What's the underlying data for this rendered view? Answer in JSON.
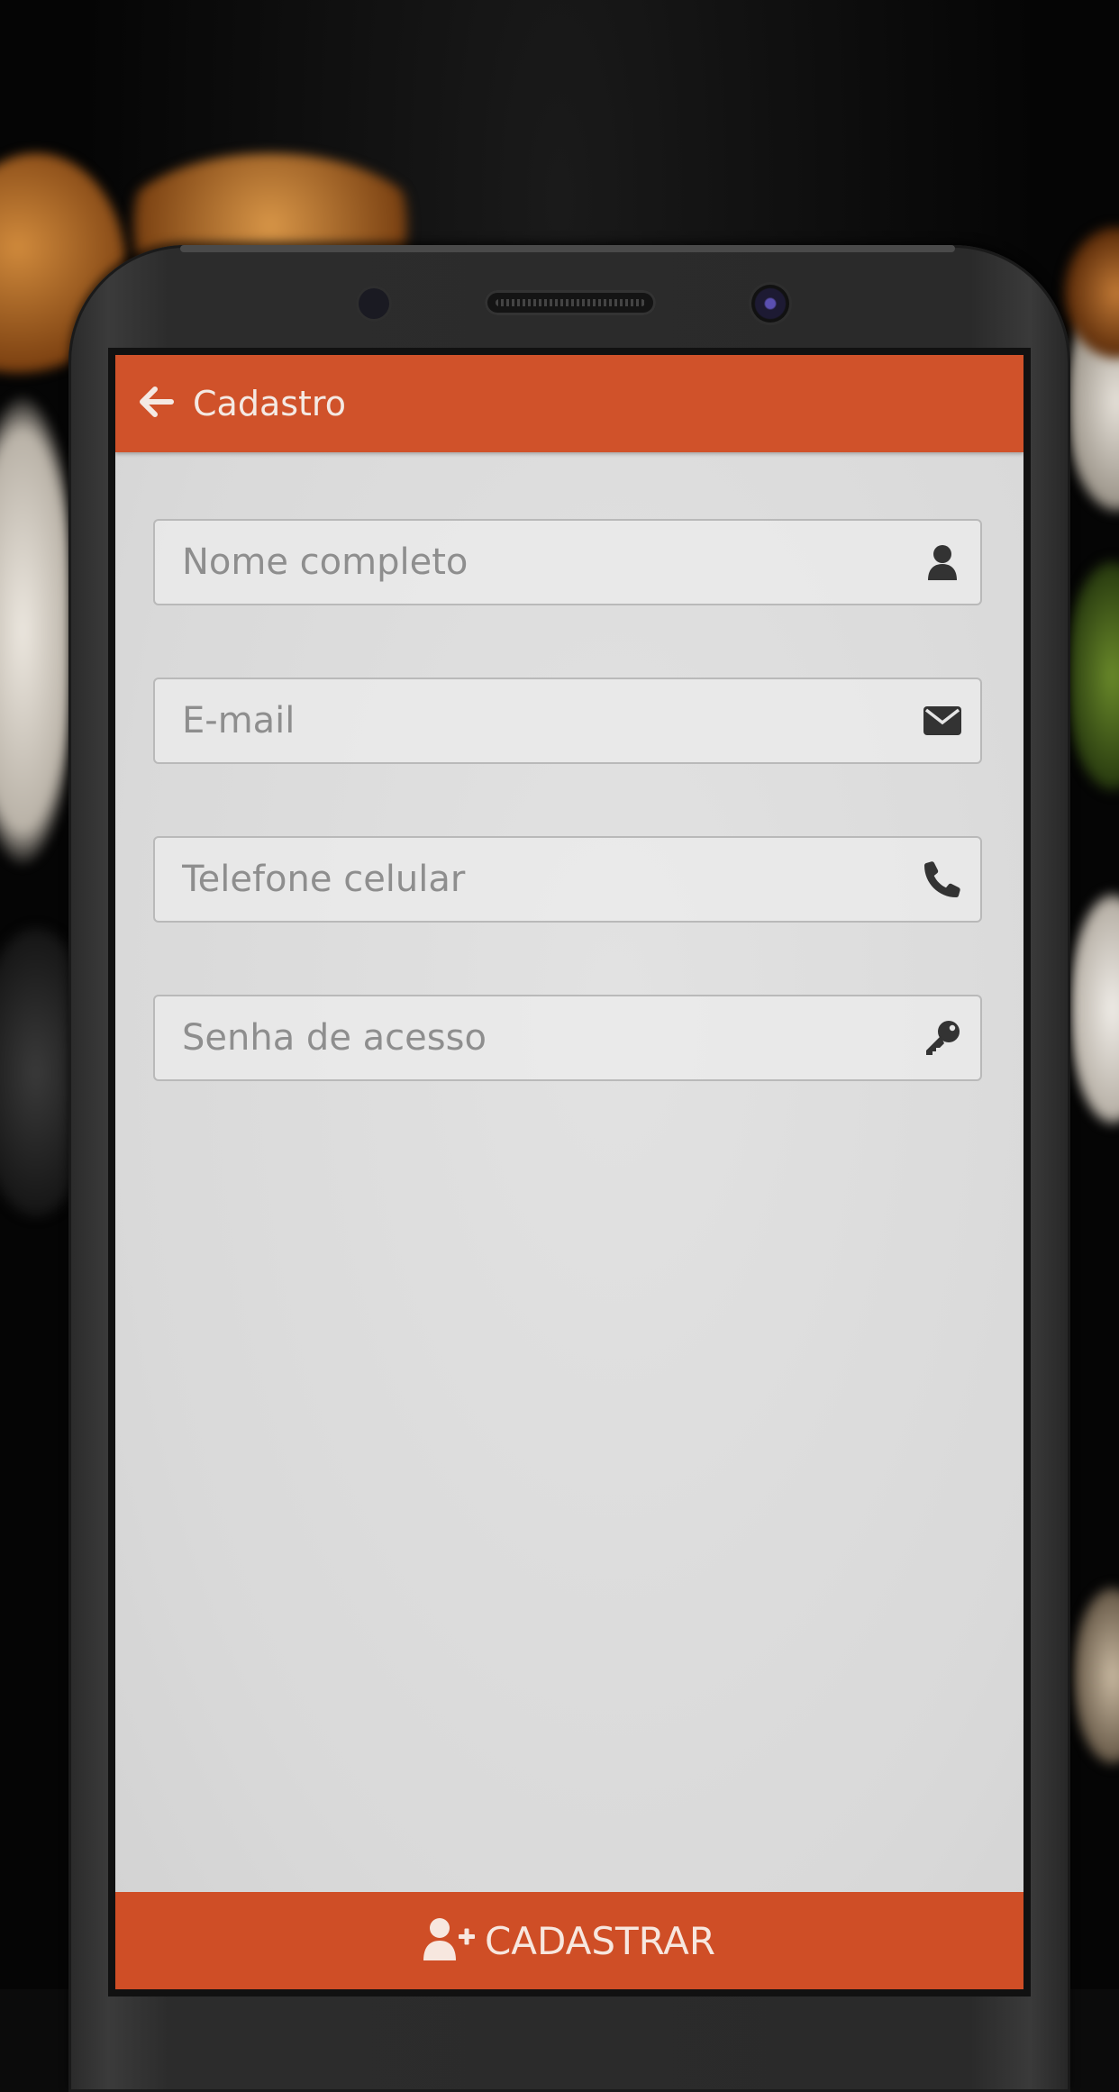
{
  "header": {
    "title": "Cadastro",
    "back_icon": "arrow-left-icon"
  },
  "form": {
    "full_name": {
      "placeholder": "Nome completo",
      "value": "",
      "icon": "user-icon"
    },
    "email": {
      "placeholder": "E-mail",
      "value": "",
      "icon": "envelope-icon"
    },
    "phone": {
      "placeholder": "Telefone celular",
      "value": "",
      "icon": "phone-icon"
    },
    "password": {
      "placeholder": "Senha de acesso",
      "value": "",
      "icon": "key-icon"
    }
  },
  "submit": {
    "label": "CADASTRAR",
    "icon": "user-plus-icon"
  },
  "colors": {
    "accent": "#d0522a",
    "screen_bg": "#dcdcdc",
    "placeholder": "#8e8e8e",
    "icon": "#333333"
  }
}
